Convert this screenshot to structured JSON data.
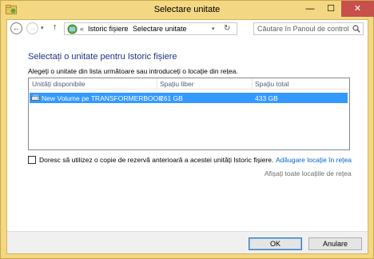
{
  "window": {
    "title": "Selectare unitate",
    "controls": {
      "minimize": "—",
      "maximize": "☐",
      "close": "✕"
    }
  },
  "nav": {
    "back": "←",
    "forward": "→",
    "recent": "▾",
    "up": "↑",
    "breadcrumb_chevron": "«",
    "breadcrumb": [
      "Istoric fișiere",
      "Selectare unitate"
    ],
    "breadcrumb_separator": "›",
    "address_dropdown": "▾",
    "refresh": "↻"
  },
  "search": {
    "placeholder": "Căutare în Panoul de control"
  },
  "main": {
    "heading": "Selectați o unitate pentru Istoric fișiere",
    "instruction": "Alegeți o unitate din lista următoare sau introduceți o locație din rețea."
  },
  "table": {
    "columns": [
      "Unități disponibile",
      "Spațiu liber",
      "Spațiu total"
    ],
    "rows": [
      {
        "name": "New Volume pe TRANSFORMERBOOK",
        "free": "261 GB",
        "total": "433 GB",
        "selected": true
      }
    ]
  },
  "options": {
    "backup_checkbox_label": "Doresc să utilizez o copie de rezervă anterioară a acestei unități Istoric fișiere.",
    "backup_checked": false,
    "add_network_link": "Adăugare locație în rețea",
    "show_network_link": "Afișați toate locațiile de rețea"
  },
  "footer": {
    "ok": "OK",
    "cancel": "Anulare"
  },
  "colors": {
    "window_frame": "#f3d782",
    "heading": "#1e3287",
    "selection": "#3399ff",
    "link": "#0066cc",
    "close_button": "#c7504a"
  },
  "icons": [
    "file-history-icon",
    "back-arrow-icon",
    "forward-arrow-icon",
    "up-arrow-icon",
    "control-panel-icon",
    "refresh-icon",
    "search-icon",
    "drive-icon"
  ]
}
